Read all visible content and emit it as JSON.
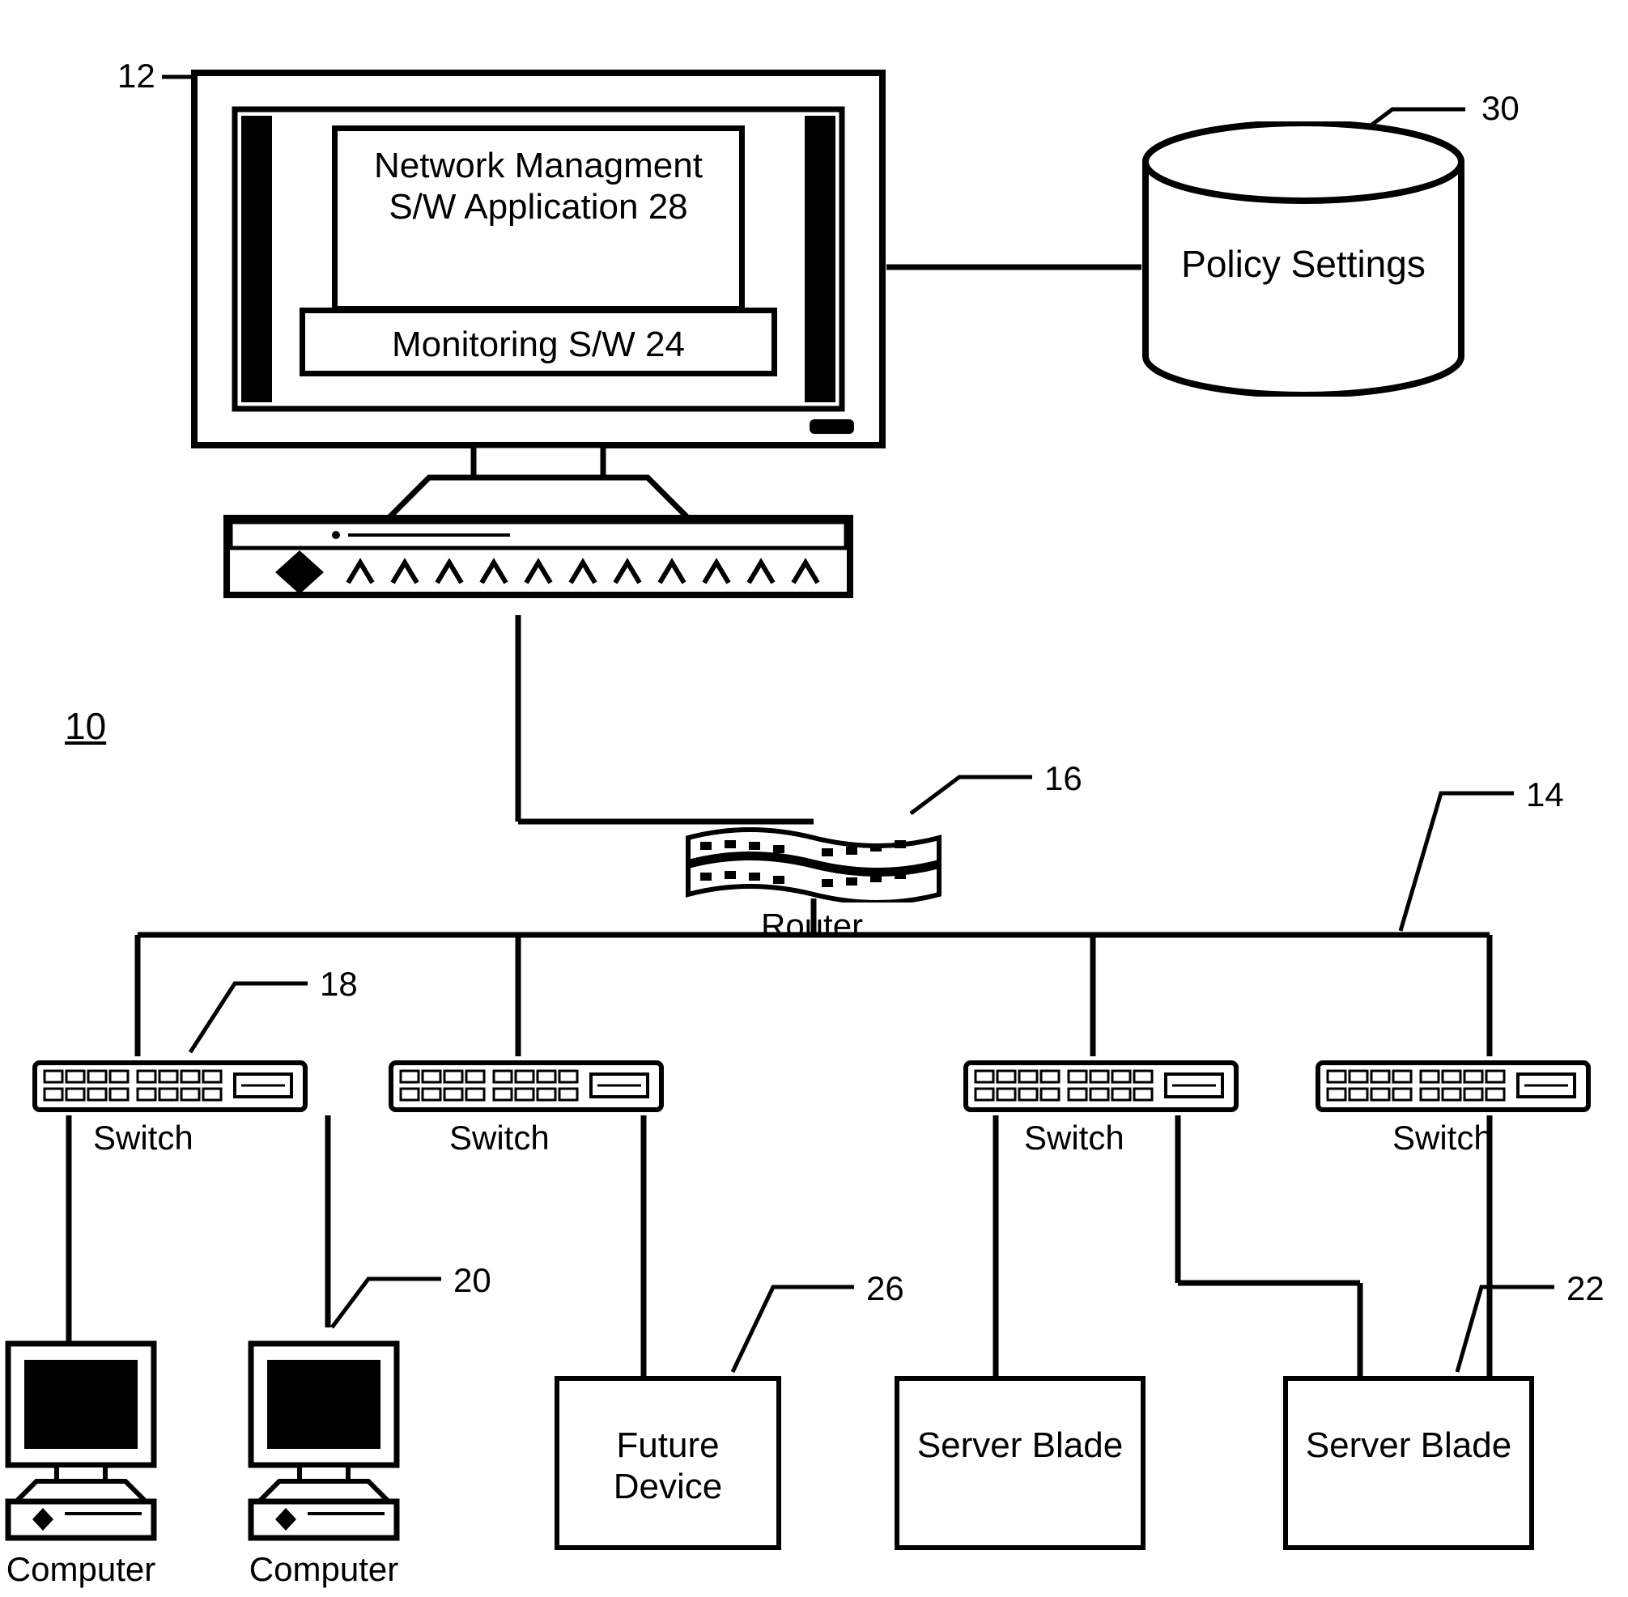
{
  "figure_ref": "10",
  "callouts": {
    "monitor": "12",
    "policy_db": "30",
    "router": "16",
    "network": "14",
    "switch": "18",
    "computer": "20",
    "future_device": "26",
    "server_blade": "22"
  },
  "monitor": {
    "app_window": "Network Managment S/W Application 28",
    "monitoring_window": "Monitoring S/W 24"
  },
  "policy_db": {
    "label": "Policy Settings"
  },
  "router": {
    "label": "Router"
  },
  "switch": {
    "label": "Switch"
  },
  "computer": {
    "label": "Computer"
  },
  "future_device": {
    "label": "Future Device"
  },
  "server_blade": {
    "label": "Server Blade"
  }
}
